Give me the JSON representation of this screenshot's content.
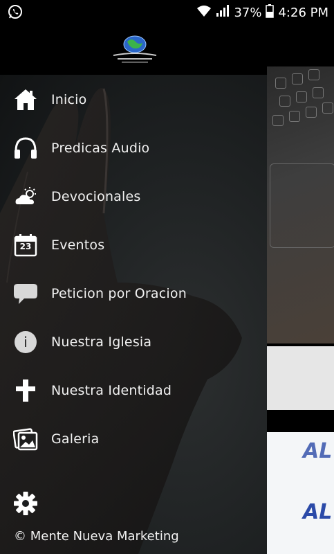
{
  "status_bar": {
    "left_icon": "whatsapp-icon",
    "battery_percent": "37%",
    "time": "4:26 PM"
  },
  "menu": {
    "items": [
      {
        "label": "Inicio",
        "icon": "home-icon"
      },
      {
        "label": "Predicas Audio",
        "icon": "headphones-icon"
      },
      {
        "label": "Devocionales",
        "icon": "cloud-sun-icon"
      },
      {
        "label": "Eventos",
        "icon": "calendar-icon",
        "icon_text": "23"
      },
      {
        "label": "Peticion por Oracion",
        "icon": "speech-bubble-icon"
      },
      {
        "label": "Nuestra Iglesia",
        "icon": "info-icon",
        "icon_text": "i"
      },
      {
        "label": "Nuestra Identidad",
        "icon": "cross-icon"
      },
      {
        "label": "Galeria",
        "icon": "gallery-icon"
      }
    ]
  },
  "footer": {
    "settings_icon": "gear-icon",
    "copyright": "© Mente Nueva Marketing"
  },
  "background": {
    "partial_logo_text": "AL"
  }
}
